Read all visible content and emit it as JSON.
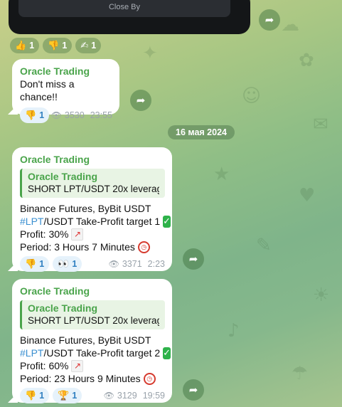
{
  "top_card": {
    "label": "Close By"
  },
  "top_reactions": [
    {
      "emoji": "👍",
      "count": "1"
    },
    {
      "emoji": "👎",
      "count": "1"
    },
    {
      "emoji": "✍",
      "count": "1"
    }
  ],
  "messages": [
    {
      "sender": "Oracle Trading",
      "text": "Don't miss a chance!!",
      "reactions": [
        {
          "emoji": "👎",
          "count": "1"
        }
      ],
      "views": "3530",
      "time": "23:55"
    },
    {
      "sender": "Oracle Trading",
      "reply": {
        "name": "Oracle Trading",
        "text": "SHORT LPT/USDT   20x leverag..."
      },
      "line1": "Binance Futures, ByBit USDT",
      "hashtag": "#LPT",
      "line2_rest": "/USDT Take-Profit target 1",
      "profit": "Profit: 30%",
      "period": "Period: 3 Hours 7 Minutes",
      "reactions": [
        {
          "emoji": "👎",
          "count": "1"
        },
        {
          "emoji": "👀",
          "count": "1"
        }
      ],
      "views": "3371",
      "time": "2:23"
    },
    {
      "sender": "Oracle Trading",
      "reply": {
        "name": "Oracle Trading",
        "text": "SHORT LPT/USDT   20x leverag..."
      },
      "line1": "Binance Futures, ByBit USDT",
      "hashtag": "#LPT",
      "line2_rest": "/USDT Take-Profit target 2",
      "profit": "Profit: 60%",
      "period": "Period:  23 Hours 9 Minutes",
      "reactions": [
        {
          "emoji": "👎",
          "count": "1"
        },
        {
          "emoji": "🏆",
          "count": "1"
        }
      ],
      "views": "3129",
      "time": "19:59"
    }
  ],
  "date_separator": "16 мая 2024",
  "icons": {
    "share": "share-arrow-icon",
    "views": "eye-icon",
    "check": "check-mark-icon",
    "chart": "chart-up-icon",
    "clock": "alarm-clock-icon"
  },
  "colors": {
    "sender": "#4aa44b",
    "hashtag": "#3a8fd0",
    "reaction_bg": "#e6f2fb"
  }
}
